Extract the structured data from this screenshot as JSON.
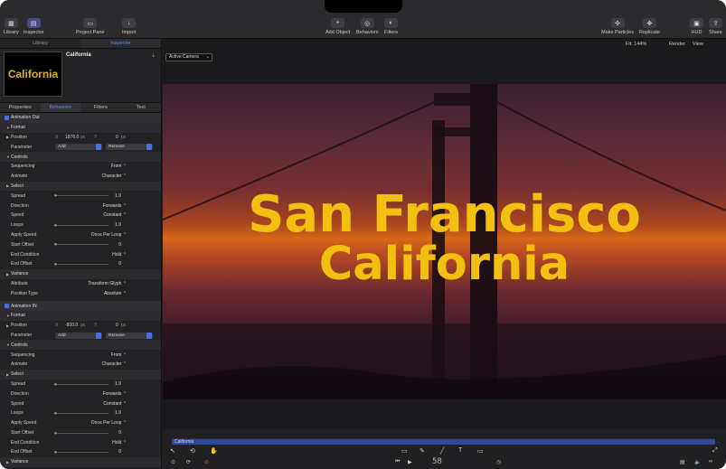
{
  "toolbar": {
    "library": "Library",
    "inspector": "Inspector",
    "project_pane": "Project Pane",
    "import": "Import",
    "add_object": "Add Object",
    "behaviors": "Behaviors",
    "filters": "Filters",
    "make_particles": "Make Particles",
    "replicate": "Replicate",
    "hud": "HUD",
    "share": "Share"
  },
  "canvas_top": {
    "fit": "Fit: 144%",
    "render": "Render",
    "view": "View",
    "active_camera": "Active Camera"
  },
  "panel": {
    "tab_library": "Library",
    "tab_inspector": "Inspector",
    "preview_title": "California",
    "thumb_text": "California",
    "insp_tabs": [
      "Properties",
      "Behaviors",
      "Filters",
      "Text"
    ]
  },
  "props": {
    "anim_out": "Animation Out",
    "format": "Format",
    "position": "Position",
    "pos_x_label": "X",
    "pos_x": "1876.0",
    "pos_x_unit": "px",
    "pos_y_label": "Y",
    "pos_y": "0",
    "pos_y_unit": "px",
    "parameter": "Parameter",
    "add": "Add",
    "remove": "Remove",
    "controls": "Controls",
    "sequencing": "Sequencing",
    "sequencing_val": "From ⌃",
    "animate": "Animate",
    "animate_val": "Character ⌃",
    "select": "Select",
    "spread": "Spread",
    "spread_val": "1.0",
    "direction": "Direction",
    "direction_val": "Forwards ⌃",
    "speed": "Speed",
    "speed_val": "Constant ⌃",
    "loops": "Loops",
    "loops_val": "1.0",
    "apply_speed": "Apply Speed",
    "apply_speed_val": "Once Per Loop ⌃",
    "start_offset": "Start Offset",
    "start_offset_val": "0",
    "end_condition": "End Condition",
    "end_condition_val": "Hold ⌃",
    "end_offset": "End Offset",
    "end_offset_val": "0",
    "variance": "Variance",
    "attribute": "Attribute",
    "attribute_val": "Transform Glyph ⌃",
    "position_type": "Position Type",
    "position_type_val": "Absolute ⌃",
    "anim_in": "Animation IN",
    "format2": "Format",
    "position2": "Position",
    "pos2_x": "-800.0",
    "pos2_y": "0",
    "parameter2": "Parameter",
    "controls2": "Controls",
    "variance2": "Variance"
  },
  "scene": {
    "line1": "San Francisco",
    "line2": "California"
  },
  "timeline": {
    "clip": "California",
    "timecode": "58"
  },
  "colors": {
    "accent": "#4a6fe0",
    "title_gold": "#f2c010"
  }
}
